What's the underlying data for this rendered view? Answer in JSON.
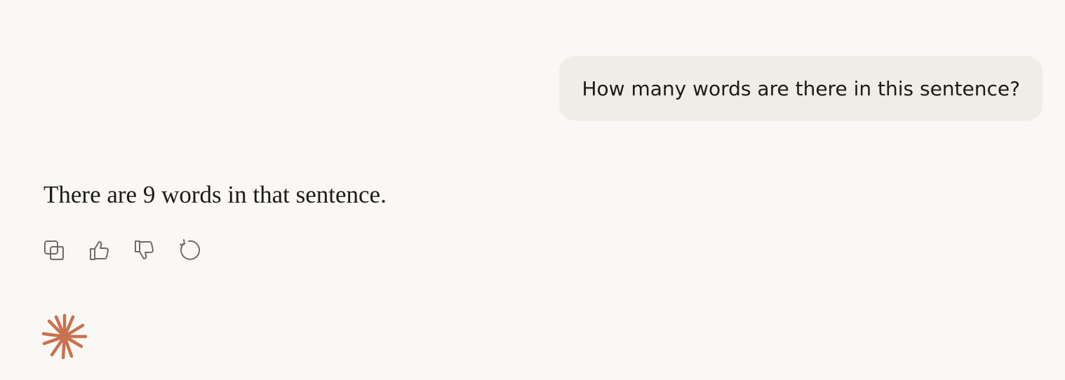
{
  "conversation": {
    "user_message": "How many words are there in this sentence?",
    "assistant_message": "There are 9 words in that sentence."
  },
  "actions": [
    {
      "name": "copy",
      "icon": "copy-icon"
    },
    {
      "name": "like",
      "icon": "thumbs-up-icon"
    },
    {
      "name": "dislike",
      "icon": "thumbs-down-icon"
    },
    {
      "name": "retry",
      "icon": "retry-icon"
    }
  ],
  "colors": {
    "background": "#f9f8f5",
    "user_bubble": "#f0ede7",
    "text": "#1c1b18",
    "icon": "#6f6c66",
    "brand_spark": "#c9714f"
  },
  "logo": {
    "icon": "sparkle-logo-icon"
  }
}
